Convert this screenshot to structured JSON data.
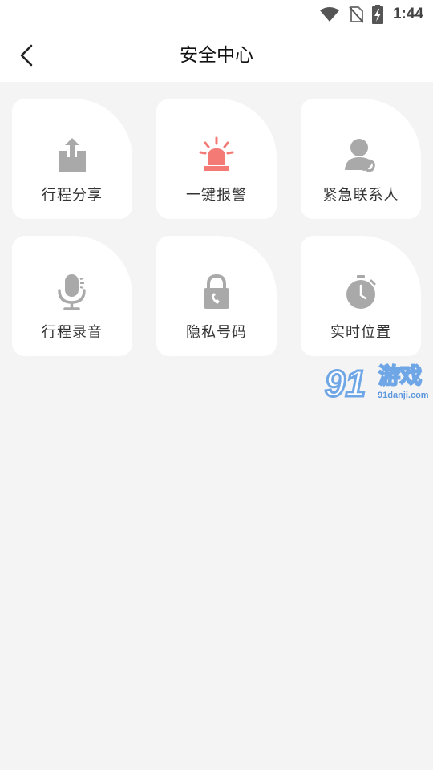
{
  "status_bar": {
    "time": "1:44",
    "icons": [
      "wifi-icon",
      "no-sim-icon",
      "battery-charging-icon"
    ]
  },
  "nav": {
    "title": "安全中心",
    "back_icon": "chevron-left-icon"
  },
  "cards": [
    {
      "label": "行程分享",
      "icon": "share-upload-icon",
      "color": "#a9a9a9"
    },
    {
      "label": "一键报警",
      "icon": "alarm-siren-icon",
      "color": "#f47a76"
    },
    {
      "label": "紧急联系人",
      "icon": "contact-person-icon",
      "color": "#a9a9a9"
    },
    {
      "label": "行程录音",
      "icon": "microphone-icon",
      "color": "#a9a9a9"
    },
    {
      "label": "隐私号码",
      "icon": "privacy-lock-phone-icon",
      "color": "#a9a9a9"
    },
    {
      "label": "实时位置",
      "icon": "stopwatch-icon",
      "color": "#a9a9a9"
    }
  ],
  "watermark": {
    "number": "91",
    "text": "游戏",
    "url": "91danji.com"
  }
}
